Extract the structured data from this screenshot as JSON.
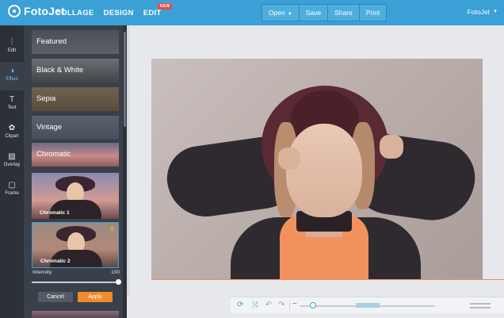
{
  "app": {
    "logo_text": "FotoJet",
    "nav": [
      "COLLAGE",
      "DESIGN",
      "EDIT"
    ],
    "new_badge": "NEW",
    "user_name": "FotoJet"
  },
  "toolbar": {
    "open_label": "Open",
    "save_label": "Save",
    "share_label": "Share",
    "print_label": "Print"
  },
  "rail": {
    "items": [
      {
        "label": "Edit",
        "icon": "sliders-icon"
      },
      {
        "label": "Effect",
        "icon": "effect-icon"
      },
      {
        "label": "Text",
        "icon": "text-icon"
      },
      {
        "label": "Clipart",
        "icon": "clipart-icon"
      },
      {
        "label": "Overlay",
        "icon": "overlay-icon"
      },
      {
        "label": "Frame",
        "icon": "frame-icon"
      }
    ]
  },
  "effects": {
    "categories": [
      "Featured",
      "Black & White",
      "Sepia",
      "Vintage",
      "Chromatic"
    ],
    "thumbnails": [
      "Chromatic 1",
      "Chromatic 2"
    ],
    "intensity_label": "Intensity",
    "intensity_value": "100",
    "intensity_fraction": 1.0,
    "cancel_label": "Cancel",
    "apply_label": "Apply"
  },
  "colors": {
    "brand": "#3aa0d6",
    "accent": "#f08a2c",
    "panel_bg": "#3a4049",
    "rail_bg": "#2c3138"
  },
  "zoom": {
    "level_fraction": 0.07
  }
}
